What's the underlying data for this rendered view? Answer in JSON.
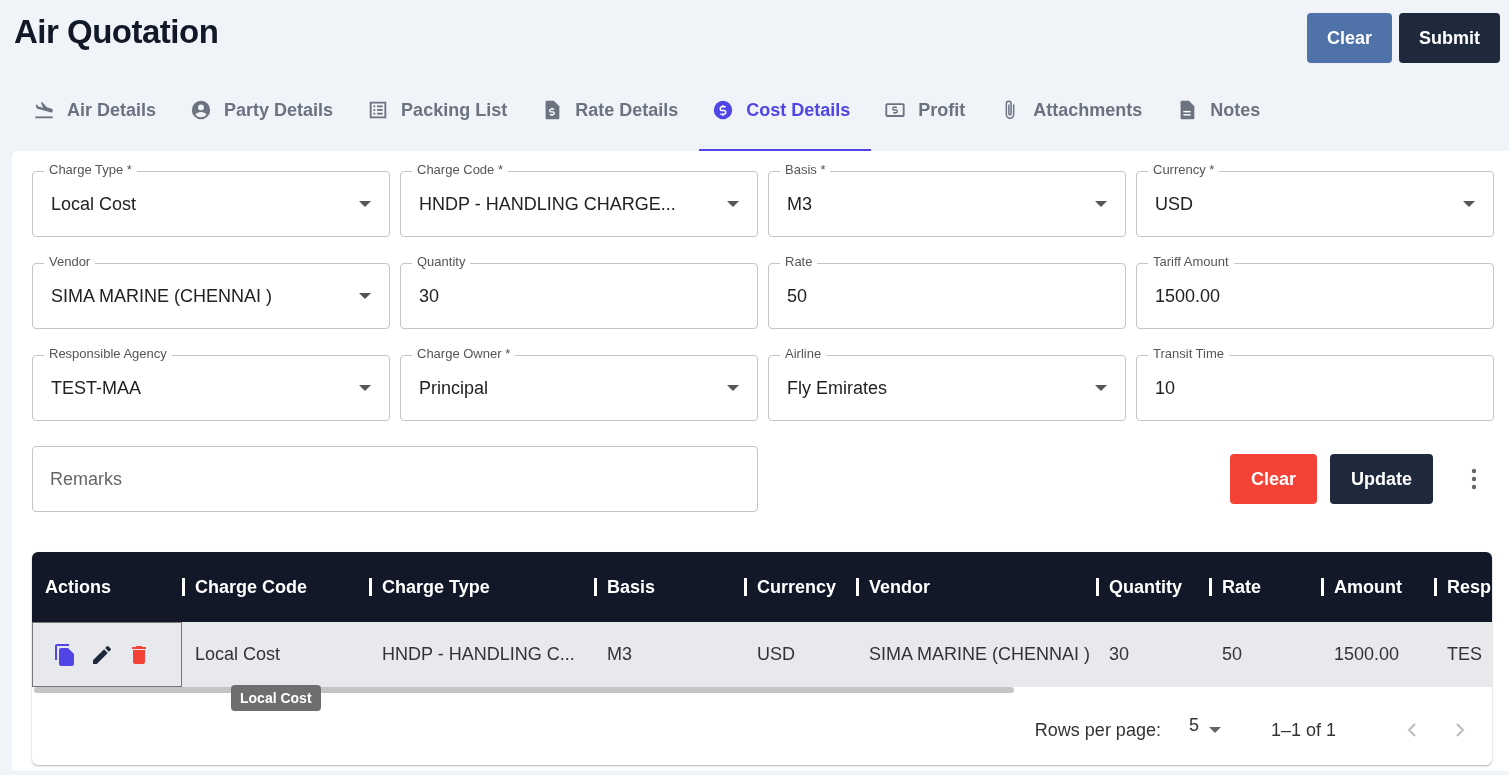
{
  "title": "Air Quotation",
  "header_buttons": [
    {
      "label": "Clear",
      "kind": "secondary"
    },
    {
      "label": "Submit",
      "kind": "primary"
    }
  ],
  "tabs": [
    {
      "label": "Air Details",
      "selected": false
    },
    {
      "label": "Party Details",
      "selected": false
    },
    {
      "label": "Packing List",
      "selected": false
    },
    {
      "label": "Rate Details",
      "selected": false
    },
    {
      "label": "Cost Details",
      "selected": true
    },
    {
      "label": "Profit",
      "selected": false
    },
    {
      "label": "Attachments",
      "selected": false
    },
    {
      "label": "Notes",
      "selected": false
    }
  ],
  "fields": [
    {
      "label": "Charge Type *",
      "value": "Local Cost",
      "kind": "select"
    },
    {
      "label": "Charge Code *",
      "value": "HNDP - HANDLING CHARGE...",
      "kind": "select"
    },
    {
      "label": "Basis *",
      "value": "M3",
      "kind": "select"
    },
    {
      "label": "Currency *",
      "value": "USD",
      "kind": "select"
    },
    {
      "label": "Vendor",
      "value": "SIMA MARINE (CHENNAI )",
      "kind": "select"
    },
    {
      "label": "Quantity",
      "value": "30",
      "kind": "text"
    },
    {
      "label": "Rate",
      "value": "50",
      "kind": "text"
    },
    {
      "label": "Tariff Amount",
      "value": "1500.00",
      "kind": "text"
    },
    {
      "label": "Responsible Agency",
      "value": "TEST-MAA",
      "kind": "select"
    },
    {
      "label": "Charge Owner *",
      "value": "Principal",
      "kind": "select"
    },
    {
      "label": "Airline",
      "value": "Fly Emirates",
      "kind": "select"
    },
    {
      "label": "Transit Time",
      "value": "10",
      "kind": "text"
    }
  ],
  "remarks": {
    "placeholder": "Remarks"
  },
  "form_buttons": [
    {
      "label": "Clear",
      "kind": "danger"
    },
    {
      "label": "Update",
      "kind": "primary"
    }
  ],
  "table": {
    "actions_column": "Actions",
    "columns": [
      "Charge Code",
      "Charge Type",
      "Basis",
      "Currency",
      "Vendor",
      "Quantity",
      "Rate",
      "Amount",
      "Resp"
    ],
    "rows": [
      {
        "cells": [
          "Local Cost",
          "HNDP - HANDLING C...",
          "M3",
          "USD",
          "SIMA MARINE (CHENNAI )",
          "30",
          "50",
          "1500.00",
          "TES"
        ]
      }
    ]
  },
  "tooltip": "Local Cost",
  "pagination": {
    "rows_per_page_label": "Rows per page:",
    "rows_per_page": "5",
    "range": "1–1 of 1",
    "prev_disabled": true,
    "next_disabled": true
  }
}
